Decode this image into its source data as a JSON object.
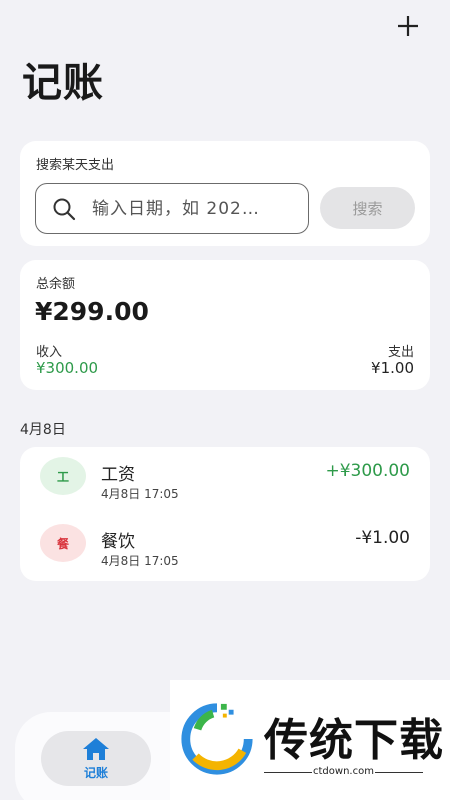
{
  "header": {
    "title": "记账",
    "add_icon": "plus-icon"
  },
  "search": {
    "label": "搜索某天支出",
    "placeholder": "输入日期，如 202…",
    "icon": "search-icon",
    "button_label": "搜索"
  },
  "summary": {
    "balance_label": "总余额",
    "balance_value": "¥299.00",
    "income_label": "收入",
    "income_value": "¥300.00",
    "expense_label": "支出",
    "expense_value": "¥1.00"
  },
  "groups": [
    {
      "date": "4月8日",
      "transactions": [
        {
          "icon_text": "工",
          "name": "工资",
          "time": "4月8日 17:05",
          "amount": "+¥300.00",
          "type": "income"
        },
        {
          "icon_text": "餐",
          "name": "餐饮",
          "time": "4月8日 17:05",
          "amount": "-¥1.00",
          "type": "expense"
        }
      ]
    }
  ],
  "nav": {
    "home_label": "记账",
    "home_icon": "home-icon",
    "active_color": "#1e7fd8"
  },
  "watermark": {
    "text": "传统下载",
    "domain": "ctdown.com"
  },
  "colors": {
    "income_green": "#2e9a4a",
    "expense_red": "#d9363e",
    "background": "#f2f2f6"
  }
}
